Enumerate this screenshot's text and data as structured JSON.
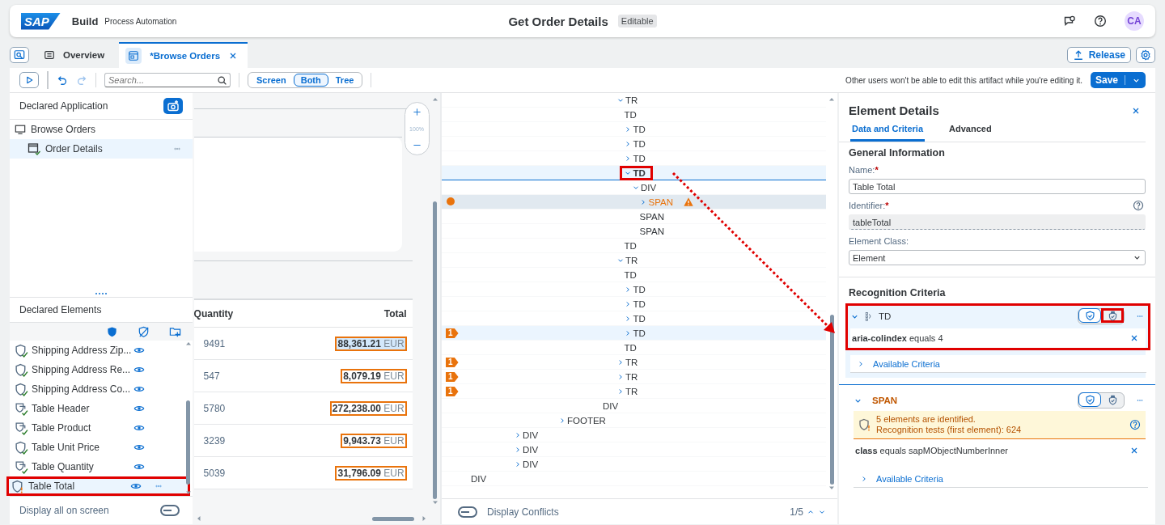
{
  "shell": {
    "logo": "SAP",
    "product": "Build",
    "subtitle": "Process Automation",
    "title": "Get Order Details",
    "badge": "Editable",
    "avatar": "CA"
  },
  "tabs": [
    {
      "label": "Overview",
      "selected": false,
      "closable": false
    },
    {
      "label": "*Browse Orders",
      "selected": true,
      "closable": true
    }
  ],
  "release": "Release",
  "toolbar": {
    "search_placeholder": "Search...",
    "views": [
      {
        "label": "Screen",
        "selected": false
      },
      {
        "label": "Both",
        "selected": true
      },
      {
        "label": "Tree",
        "selected": false
      }
    ],
    "notice": "Other users won't be able to edit this artifact while you're editing it.",
    "save": "Save"
  },
  "left": {
    "title": "Declared Application",
    "app_tree": [
      {
        "label": "Browse Orders",
        "kind": "app",
        "selected": false,
        "children": [
          {
            "label": "Order Details",
            "kind": "screen",
            "selected": true
          }
        ]
      }
    ],
    "elements_title": "Declared Elements",
    "elements": [
      {
        "label": "Shipping Address Zip...",
        "kind": "element",
        "warning": false,
        "selected": false,
        "annotated": false
      },
      {
        "label": "Shipping Address Re...",
        "kind": "element",
        "warning": false,
        "selected": false,
        "annotated": false
      },
      {
        "label": "Shipping Address Co...",
        "kind": "element",
        "warning": false,
        "selected": false,
        "annotated": false
      },
      {
        "label": "Table Header",
        "kind": "group",
        "warning": false,
        "selected": false,
        "annotated": false
      },
      {
        "label": "Table Product",
        "kind": "group",
        "warning": false,
        "selected": false,
        "annotated": false
      },
      {
        "label": "Table Unit Price",
        "kind": "element",
        "warning": false,
        "selected": false,
        "annotated": false
      },
      {
        "label": "Table Quantity",
        "kind": "group",
        "warning": false,
        "selected": false,
        "annotated": false
      },
      {
        "label": "Table Total",
        "kind": "element",
        "warning": true,
        "selected": true,
        "annotated": true
      }
    ],
    "display_all": {
      "label": "Display all on screen",
      "on": false
    }
  },
  "preview": {
    "zoom": "100%",
    "columns": [
      "Quantity",
      "Total"
    ],
    "rows": [
      {
        "quantity": "9491",
        "amount": "88,361.21",
        "currency": "EUR",
        "selected": true
      },
      {
        "quantity": "547",
        "amount": "8,079.19",
        "currency": "EUR",
        "selected": false
      },
      {
        "quantity": "5780",
        "amount": "272,238.00",
        "currency": "EUR",
        "selected": false
      },
      {
        "quantity": "3239",
        "amount": "9,943.73",
        "currency": "EUR",
        "selected": false
      },
      {
        "quantity": "5039",
        "amount": "31,796.09",
        "currency": "EUR",
        "selected": false
      }
    ]
  },
  "tree": {
    "nodes": [
      {
        "label": "TR",
        "expanded": true,
        "selected": false,
        "children": [
          {
            "label": "TD",
            "selected": false
          },
          {
            "label": "TD",
            "expanded": false,
            "selected": false
          },
          {
            "label": "TD",
            "expanded": false,
            "selected": false
          },
          {
            "label": "TD",
            "expanded": false,
            "selected": false
          },
          {
            "label": "TD",
            "expanded": true,
            "selected": true,
            "annotated": true,
            "children": [
              {
                "label": "DIV",
                "expanded": true,
                "selected": false,
                "children": [
                  {
                    "label": "SPAN",
                    "expanded": false,
                    "selected": false,
                    "current": true,
                    "warning": true
                  },
                  {
                    "label": "SPAN",
                    "selected": false
                  },
                  {
                    "label": "SPAN",
                    "selected": false
                  }
                ]
              }
            ]
          },
          {
            "label": "TD",
            "selected": false
          }
        ]
      },
      {
        "label": "TR",
        "expanded": true,
        "selected": false,
        "children": [
          {
            "label": "TD",
            "selected": false
          },
          {
            "label": "TD",
            "expanded": false,
            "selected": false
          },
          {
            "label": "TD",
            "expanded": false,
            "selected": false
          },
          {
            "label": "TD",
            "expanded": false,
            "selected": false
          },
          {
            "label": "TD",
            "expanded": false,
            "selected": false,
            "highlighted": true,
            "conflicts": "1"
          },
          {
            "label": "TD",
            "selected": false
          }
        ]
      },
      {
        "label": "TR",
        "expanded": false,
        "selected": false,
        "conflicts": "1"
      },
      {
        "label": "TR",
        "expanded": false,
        "selected": false,
        "conflicts": "1"
      },
      {
        "label": "TR",
        "expanded": false,
        "selected": false,
        "conflicts": "1"
      },
      {
        "label": "DIV",
        "selected": false
      },
      {
        "label": "FOOTER",
        "expanded": false,
        "selected": false
      },
      {
        "label": "DIV",
        "expanded": false,
        "selected": false
      },
      {
        "label": "DIV",
        "expanded": false,
        "selected": false
      },
      {
        "label": "DIV",
        "expanded": false,
        "selected": false
      },
      {
        "label": "DIV",
        "selected": false
      }
    ],
    "display_conflicts": {
      "label": "Display Conflicts",
      "on": false
    },
    "counter": "1/5"
  },
  "details": {
    "title": "Element Details",
    "tabs": [
      {
        "label": "Data and Criteria",
        "selected": true
      },
      {
        "label": "Advanced",
        "selected": false
      }
    ],
    "general_title": "General Information",
    "name": {
      "label": "Name:",
      "required_mark": "*",
      "value": "Table Total"
    },
    "identifier": {
      "label": "Identifier:",
      "required_mark": "*",
      "value": "tableTotal",
      "disabled": true
    },
    "element_class": {
      "label": "Element Class:",
      "value": "Element"
    },
    "criteria_title": "Recognition Criteria",
    "groups": [
      {
        "tag": "TD",
        "kind": "parent",
        "expanded": true,
        "selected": true,
        "annotated": true,
        "modes": [
          {
            "selected": true,
            "annotated": false
          },
          {
            "selected": false,
            "annotated": true
          }
        ],
        "criteria": [
          "**aria-colindex** equals 4"
        ],
        "available": "Available Criteria"
      },
      {
        "tag": "SPAN",
        "kind": "target",
        "expanded": true,
        "selected": false,
        "annotated": false,
        "modes": [
          {
            "selected": true,
            "annotated": false
          },
          {
            "selected": false,
            "annotated": false
          }
        ],
        "message": [
          "5 elements are identified.",
          "Recognition tests (first element): 624"
        ],
        "criteria": [
          "**class** equals sapMObjectNumberInner"
        ],
        "available": "Available Criteria"
      }
    ]
  }
}
